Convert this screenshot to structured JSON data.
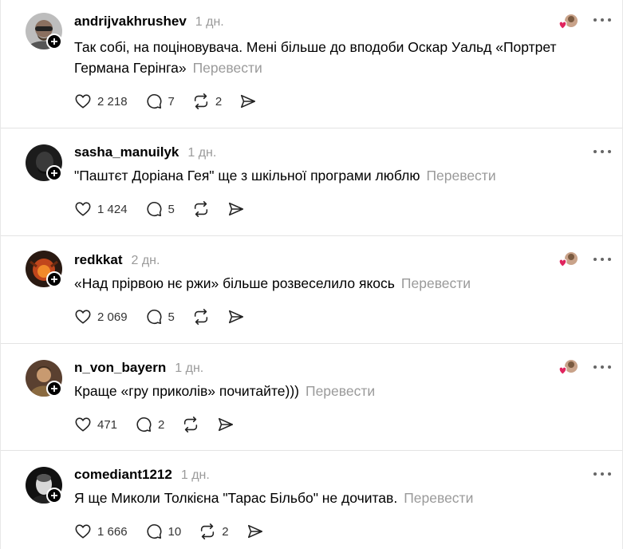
{
  "translate_label": "Перевести",
  "posts": [
    {
      "username": "andrijvakhrushev",
      "time": "1 дн.",
      "text": "Так собі, на поціновувача. Мені більше до вподоби Оскар Уальд «Портрет Германа Герінга»",
      "likes": "2 218",
      "replies": "7",
      "reposts": "2",
      "has_liked_by": true,
      "avatar_color": "#8a8a8a"
    },
    {
      "username": "sasha_manuilyk",
      "time": "1 дн.",
      "text": "\"Паштєт Доріана Гея\" ще з шкільної програми люблю",
      "likes": "1 424",
      "replies": "5",
      "reposts": "",
      "has_liked_by": false,
      "avatar_color": "#2a2a2a"
    },
    {
      "username": "redkkat",
      "time": "2 дн.",
      "text": "«Над прірвою нє ржи» більше розвеселило якось",
      "likes": "2 069",
      "replies": "5",
      "reposts": "",
      "has_liked_by": true,
      "avatar_color": "#b0401a"
    },
    {
      "username": "n_von_bayern",
      "time": "1 дн.",
      "text": "Краще «гру приколів» почитайте)))",
      "likes": "471",
      "replies": "2",
      "reposts": "",
      "has_liked_by": true,
      "avatar_color": "#7a5a3a"
    },
    {
      "username": "comediant1212",
      "time": "1 дн.",
      "text": "Я ще Миколи Толкієна \"Тарас Більбо\" не дочитав.",
      "likes": "1 666",
      "replies": "10",
      "reposts": "2",
      "has_liked_by": false,
      "avatar_color": "#1a1a1a"
    }
  ],
  "colors": {
    "muted_text": "#9a9a9a",
    "divider": "#e3e3e3",
    "heart_red": "#e0245e"
  },
  "icons": {
    "like": "heart-icon",
    "reply": "comment-icon",
    "repost": "repost-icon",
    "share": "send-icon",
    "more": "more-dots-icon",
    "follow": "plus-icon"
  }
}
